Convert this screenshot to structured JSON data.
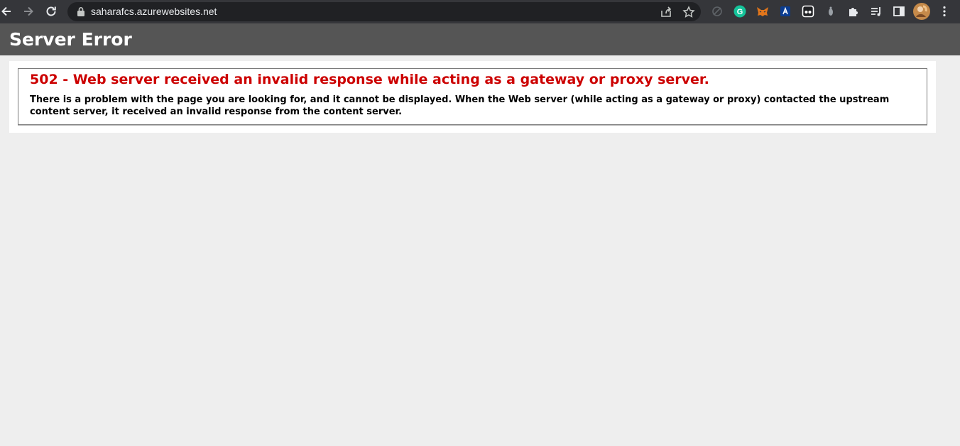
{
  "browser": {
    "url": "saharafcs.azurewebsites.net",
    "icons": {
      "back": "back-arrow-icon",
      "forward": "forward-arrow-icon",
      "reload": "reload-icon",
      "lock": "lock-icon",
      "share": "share-icon",
      "bookmark": "star-icon"
    },
    "extensions": [
      {
        "name": "disabled-extension-icon",
        "color": "#5f6368"
      },
      {
        "name": "grammarly-icon",
        "color": "#15c39a"
      },
      {
        "name": "metamask-icon",
        "color": "#e2761b"
      },
      {
        "name": "blue-extension-icon",
        "color": "#1a73e8"
      },
      {
        "name": "screen-recorder-icon",
        "color": "#ffffff"
      },
      {
        "name": "grey-extension-icon",
        "color": "#9aa0a6"
      },
      {
        "name": "puzzle-extensions-icon",
        "color": "#e8eaed"
      },
      {
        "name": "reading-list-icon",
        "color": "#e8eaed"
      },
      {
        "name": "side-panel-icon",
        "color": "#e8eaed"
      },
      {
        "name": "profile-avatar-icon",
        "color": "#c58a4a"
      },
      {
        "name": "menu-kebab-icon",
        "color": "#e8eaed"
      }
    ]
  },
  "page": {
    "title": "Server Error",
    "error_heading": "502 - Web server received an invalid response while acting as a gateway or proxy server.",
    "error_description": "There is a problem with the page you are looking for, and it cannot be displayed. When the Web server (while acting as a gateway or proxy) contacted the upstream content server, it received an invalid response from the content server."
  },
  "colors": {
    "toolbar": "#35363a",
    "omnibox": "#202124",
    "header": "#555555",
    "error_red": "#cc0000",
    "page_background": "#eeeeee"
  }
}
